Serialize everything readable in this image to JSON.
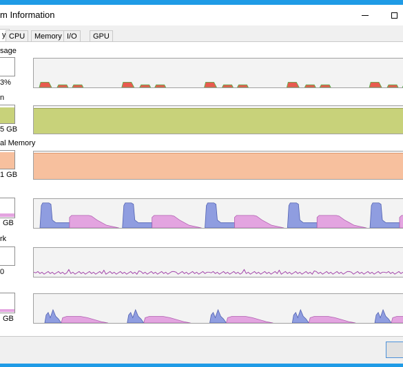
{
  "window": {
    "title": "m Information"
  },
  "tabs": [
    {
      "label": "y",
      "active": true
    },
    {
      "label": "CPU"
    },
    {
      "label": "Memory"
    },
    {
      "label": "I/O"
    },
    {
      "label": "GPU"
    }
  ],
  "sections": {
    "cpu_usage": {
      "label": "sage",
      "value": "3%"
    },
    "memory": {
      "label": "n",
      "value": "5 GB"
    },
    "virtual_memory": {
      "label": "al Memory",
      "value": "1 GB"
    },
    "io": {
      "value": "GB"
    },
    "network": {
      "label": "rk",
      "value": "0"
    },
    "disk": {
      "value": "GB"
    }
  },
  "colors": {
    "memory_fill": "#c8d27a",
    "virtual_fill": "#f7c09e",
    "io_read": "#8f9de0",
    "io_write": "#e3a4e0",
    "cpu_red": "#e85a4f",
    "cpu_green": "#4fb84f",
    "network_line": "#a040a8",
    "accent": "#1f9be6"
  }
}
